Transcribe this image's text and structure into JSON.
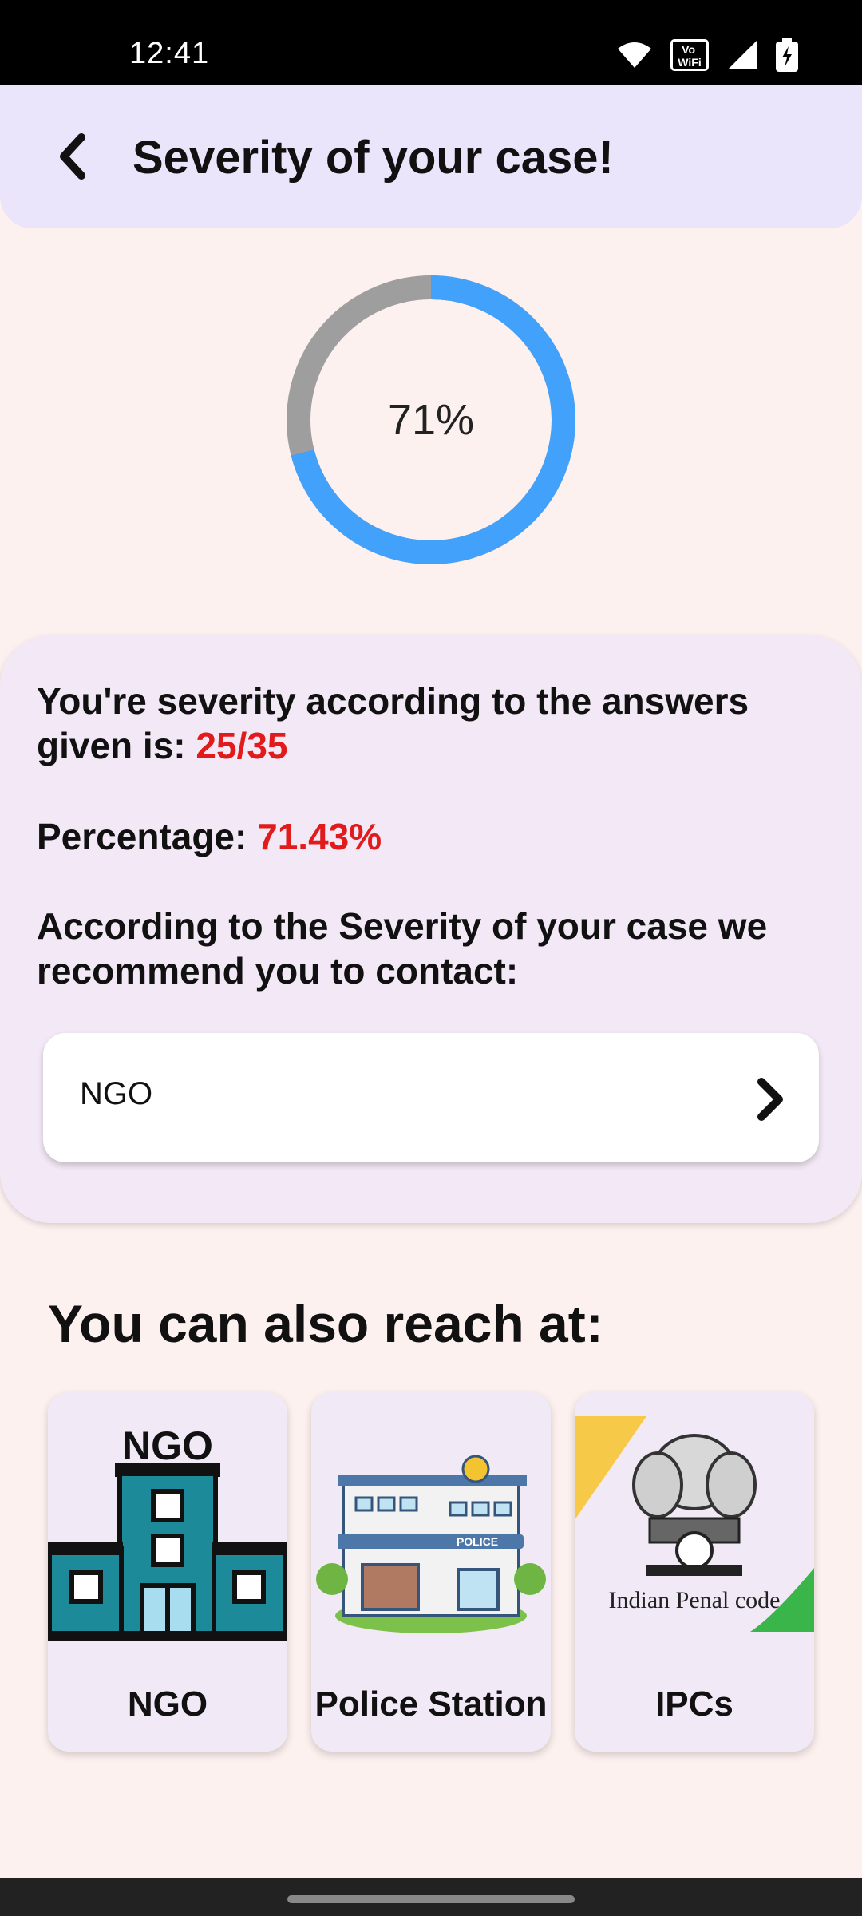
{
  "status_bar": {
    "time": "12:41",
    "wifi_badge": "Vo WiFi"
  },
  "header": {
    "title": "Severity of your case!"
  },
  "progress": {
    "percent_label": "71%",
    "fraction": 0.71,
    "fill_color": "#42a1fb",
    "track_color": "#9e9e9e"
  },
  "summary": {
    "severity_text": "You're severity according to the answers given is: ",
    "severity_value": "25/35",
    "percentage_label": "Percentage: ",
    "percentage_value": "71.43%",
    "recommend_text": "According to the Severity of your case we recommend you to contact:",
    "contact_option": "NGO"
  },
  "reach": {
    "title": "You can also reach at:",
    "tiles": [
      {
        "label": "NGO",
        "sign": "NGO"
      },
      {
        "label": "Police Station",
        "sign": "POLICE"
      },
      {
        "label": "IPCs",
        "caption": "Indian Penal code"
      }
    ]
  },
  "colors": {
    "accent_red": "#e11b1b",
    "app_bar_bg": "#ebe5fb",
    "page_bg": "#fdf1ef"
  }
}
